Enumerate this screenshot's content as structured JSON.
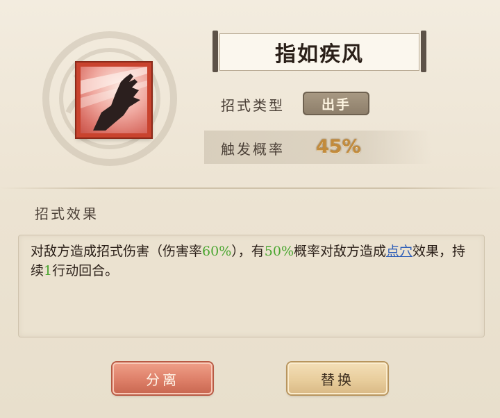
{
  "skill": {
    "name": "指如疾风",
    "icon": "claw-hand-icon"
  },
  "attributes": {
    "type_label": "招式类型",
    "type_value": "出手",
    "rate_label": "触发概率",
    "rate_value": "45%"
  },
  "effect": {
    "title": "招式效果",
    "part1": "对敌方造成招式伤害（伤害率",
    "dmg_rate": "60%",
    "part2": "），有",
    "chance": "50%",
    "part3": "概率对敌方造成",
    "status_link": "点穴",
    "part4": "效果，持续",
    "turns": "1",
    "part5": "行动回合。"
  },
  "buttons": {
    "split_label": "分离",
    "replace_label": "替换"
  },
  "colors": {
    "highlight_green": "#4aa630",
    "link_blue": "#2f5fb8",
    "rate_gold": "#c28b3c",
    "icon_frame": "#c9432e"
  }
}
